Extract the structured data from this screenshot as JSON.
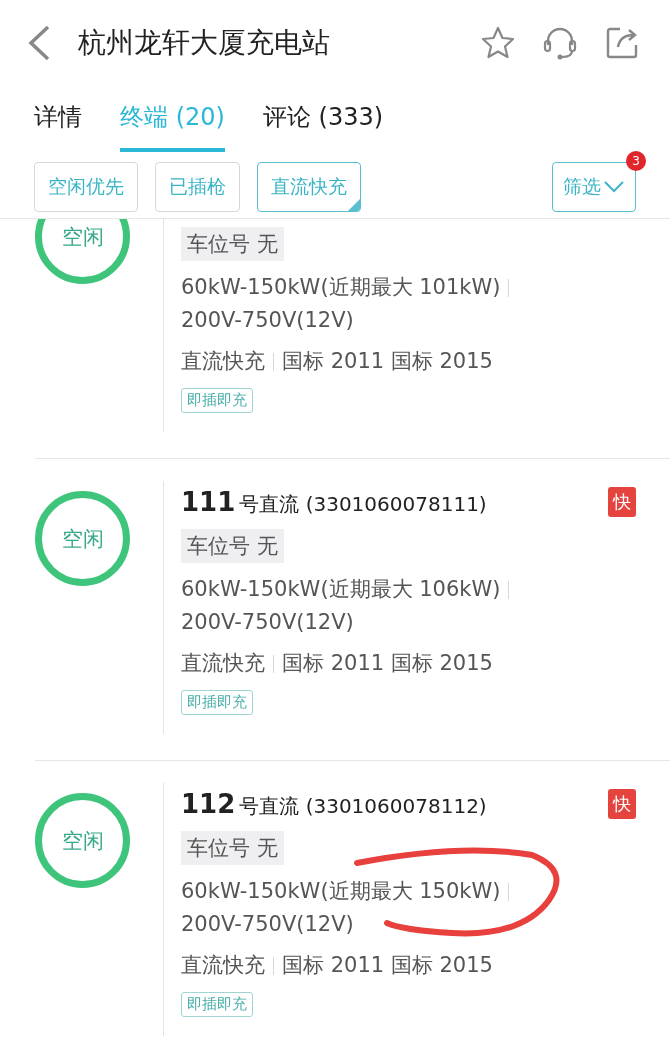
{
  "header": {
    "title": "杭州龙轩大厦充电站"
  },
  "tabs": [
    {
      "label": "详情",
      "selected": false
    },
    {
      "label": "终端 (20)",
      "selected": true
    },
    {
      "label": "评论 (333)",
      "selected": false
    }
  ],
  "filters": [
    {
      "label": "空闲优先",
      "selected": false
    },
    {
      "label": "已插枪",
      "selected": false
    },
    {
      "label": "直流快充",
      "selected": true
    }
  ],
  "filter_menu": {
    "label": "筛选",
    "badge": "3"
  },
  "terminals": [
    {
      "status": "空闲",
      "parking": "车位号 无",
      "power": "60kW-150kW(近期最大 101kW)",
      "voltage": "200V-750V(12V)",
      "type": "直流快充",
      "standards": "国标 2011 国标 2015",
      "tag": "即插即充",
      "highlighted": false
    },
    {
      "number": "111",
      "name": "号直流 (3301060078111)",
      "badge": "快",
      "status": "空闲",
      "parking": "车位号 无",
      "power": "60kW-150kW(近期最大 106kW)",
      "voltage": "200V-750V(12V)",
      "type": "直流快充",
      "standards": "国标 2011 国标 2015",
      "tag": "即插即充",
      "highlighted": false
    },
    {
      "number": "112",
      "name": "号直流 (3301060078112)",
      "badge": "快",
      "status": "空闲",
      "parking": "车位号 无",
      "power": "60kW-150kW(近期最大 150kW)",
      "voltage": "200V-750V(12V)",
      "type": "直流快充",
      "standards": "国标 2011 国标 2015",
      "tag": "即插即充",
      "highlighted": true
    }
  ]
}
